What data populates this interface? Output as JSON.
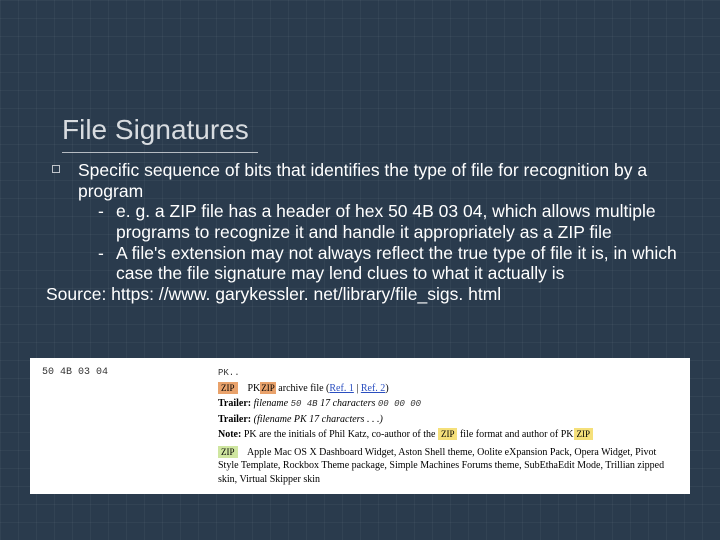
{
  "slide": {
    "title": "File Signatures",
    "bullet1": "Specific sequence of bits that identifies the type of file for recognition by a program",
    "sub1": "e. g. a ZIP file has a header of hex 50 4B 03 04, which allows multiple programs to recognize it and handle it appropriately as a ZIP file",
    "sub2": "A file's extension may not always reflect the true type of file it is, in which case the file signature may lend clues to what it actually is",
    "source": "Source: https: //www. garykessler. net/library/file_sigs. html"
  },
  "figure": {
    "hex": "50 4B 03 04",
    "pk": "PK..",
    "tag_zip": "ZIP",
    "line1_a": "PK",
    "line1_b": " archive file (",
    "line1_ref1": "Ref. 1",
    "line1_sep": " | ",
    "line1_ref2": "Ref. 2",
    "line1_c": ")",
    "trailer_label": "Trailer:",
    "trailer_a": " filename ",
    "trailer_b": "50 4B",
    "trailer_c": " 17 characters ",
    "trailer_d": "00 00 00",
    "trailer2": " (filename PK 17 characters . . .)",
    "note_label": "Note:",
    "note_a": " PK are the initials of Phil Katz, co-author of the ",
    "note_b": " file format and author of PK",
    "row2_text": "Apple Mac OS X Dashboard Widget, Aston Shell theme, Oolite eXpansion Pack, Opera Widget, Pivot Style Template, Rockbox Theme package, Simple Machines Forums theme, SubEthaEdit Mode, Trillian zipped skin, Virtual Skipper skin"
  }
}
